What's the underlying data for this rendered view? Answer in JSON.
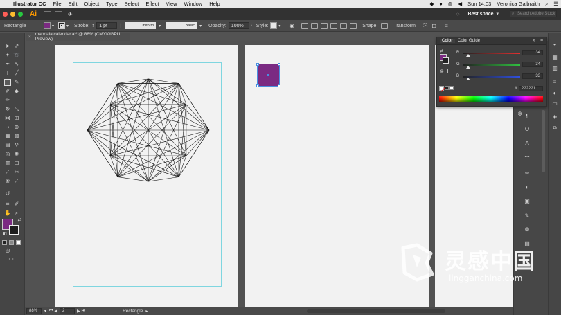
{
  "menubar": {
    "app": "Illustrator CC",
    "items": [
      "File",
      "Edit",
      "Object",
      "Type",
      "Select",
      "Effect",
      "View",
      "Window",
      "Help"
    ],
    "clock": "Sun 14:03",
    "user": "Veronica Galbraith"
  },
  "appbar": {
    "logo": "Ai",
    "workspace": "Best space",
    "search_placeholder": "Search Adobe Stock"
  },
  "control": {
    "tool_name": "Rectangle",
    "fill_color": "#7b2a82",
    "stroke_label": "Stroke:",
    "stroke_weight": "1 pt",
    "profile": "Uniform",
    "brush": "Basic",
    "opacity_label": "Opacity:",
    "opacity": "100%",
    "style_label": "Style:",
    "shape_label": "Shape:",
    "transform_label": "Transform"
  },
  "document": {
    "tab_title": "mandala calendar.ai* @ 88% (CMYK/GPU Preview)"
  },
  "status": {
    "zoom": "88%",
    "artboard": "2",
    "tool": "Rectangle"
  },
  "color_panel": {
    "tabs": [
      "Color",
      "Color Guide"
    ],
    "channels": [
      {
        "label": "R",
        "value": "34",
        "color": "#e03030"
      },
      {
        "label": "G",
        "value": "34",
        "color": "#30c040"
      },
      {
        "label": "B",
        "value": "33",
        "color": "#3050e0"
      }
    ],
    "hex_label": "#",
    "hex": "222221"
  },
  "colors": {
    "accent_purple": "#7b2a82",
    "artboard": "#f2f2f2",
    "guide": "#7fd6e0"
  },
  "watermark": {
    "text": "灵感中国",
    "url": "lingganchina.com"
  }
}
